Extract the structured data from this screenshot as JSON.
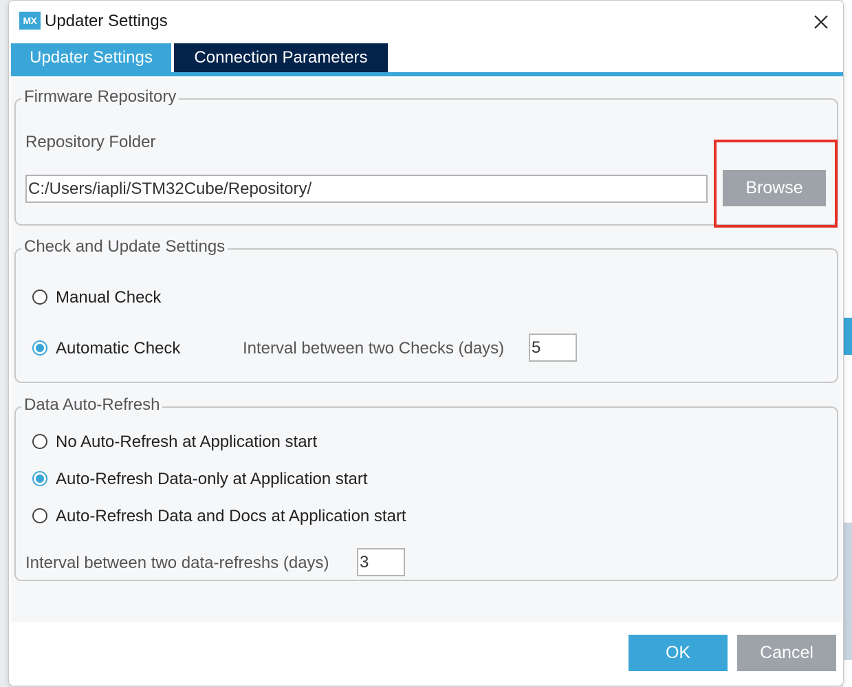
{
  "window": {
    "title": "Updater Settings",
    "logo_text": "MX"
  },
  "tabs": [
    {
      "label": "Updater Settings",
      "active": true
    },
    {
      "label": "Connection Parameters",
      "active": false
    }
  ],
  "firmware": {
    "legend": "Firmware Repository",
    "folder_label": "Repository Folder",
    "folder_value": "C:/Users/iapli/STM32Cube/Repository/",
    "browse_label": "Browse"
  },
  "check": {
    "legend": "Check and Update Settings",
    "manual_label": "Manual Check",
    "automatic_label": "Automatic Check",
    "interval_label": "Interval between two Checks (days)",
    "interval_value": "5",
    "selected": "automatic"
  },
  "refresh": {
    "legend": "Data Auto-Refresh",
    "options": [
      {
        "label": "No Auto-Refresh at Application start",
        "checked": false
      },
      {
        "label": "Auto-Refresh Data-only at Application start",
        "checked": true
      },
      {
        "label": "Auto-Refresh Data and Docs at Application start",
        "checked": false
      }
    ],
    "interval_label": "Interval between two data-refreshs (days)",
    "interval_value": "3"
  },
  "footer": {
    "ok_label": "OK",
    "cancel_label": "Cancel"
  },
  "colors": {
    "accent": "#3aa6d8",
    "tab_dark": "#03234b",
    "highlight": "#e53228",
    "button_gray": "#9da3a8"
  }
}
